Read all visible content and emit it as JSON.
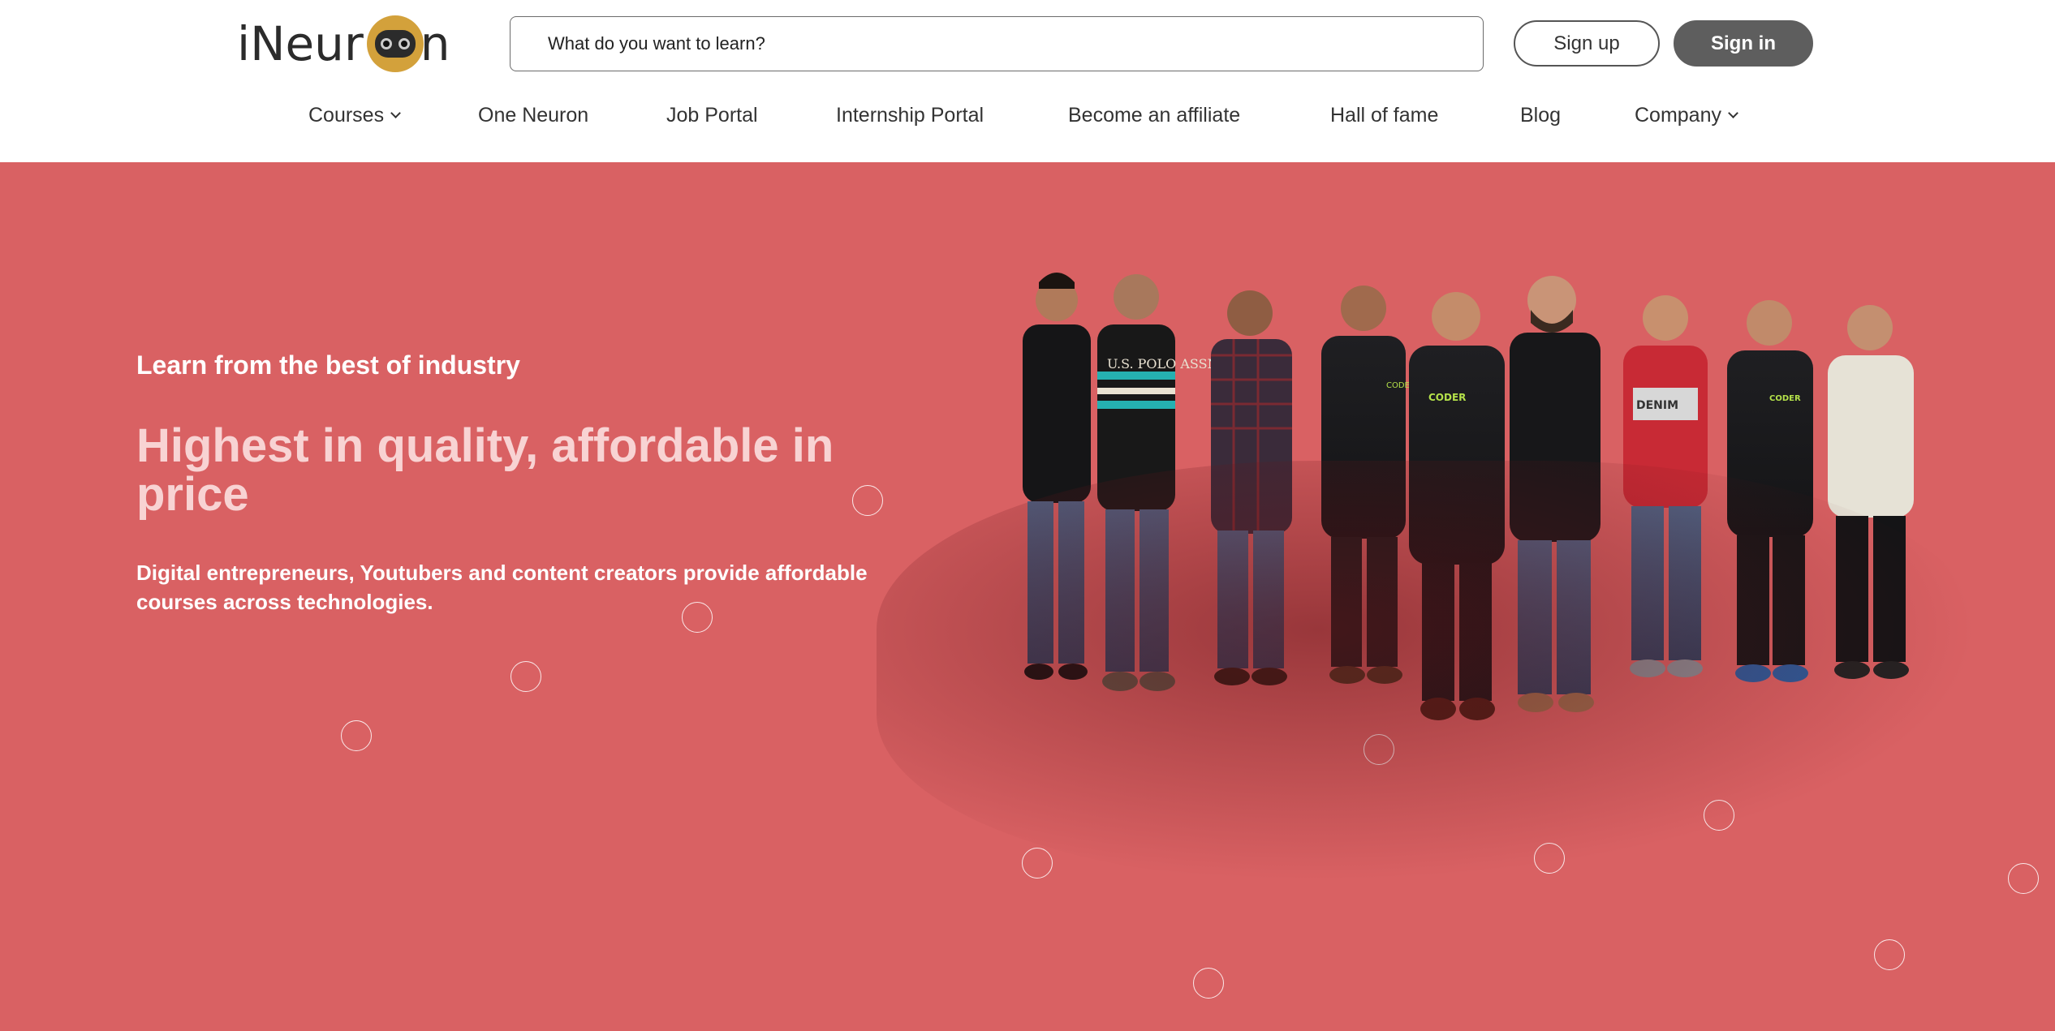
{
  "logo": {
    "text_before": "iNeur",
    "text_after": "n"
  },
  "search": {
    "placeholder": "What do you want to learn?"
  },
  "auth": {
    "signup_label": "Sign up",
    "signin_label": "Sign in"
  },
  "nav": {
    "items": [
      {
        "label": "Courses",
        "dropdown": true
      },
      {
        "label": "One Neuron",
        "dropdown": false
      },
      {
        "label": "Job Portal",
        "dropdown": false
      },
      {
        "label": "Internship Portal",
        "dropdown": false
      },
      {
        "label": "Become an affiliate",
        "dropdown": false
      },
      {
        "label": "Hall of fame",
        "dropdown": false
      },
      {
        "label": "Blog",
        "dropdown": false
      },
      {
        "label": "Company",
        "dropdown": true
      }
    ]
  },
  "hero": {
    "kicker": "Learn from the best of industry",
    "headline": "Highest in quality, affordable in price",
    "description": "Digital entrepreneurs, Youtubers and content creators provide affordable courses across technologies.",
    "background_color": "#d96163",
    "team_photo": "team-photo-nine-people",
    "shirt_texts": [
      "U.S. POLO ASSN",
      "CODER",
      "CODER",
      "CODER",
      "DENIM"
    ]
  },
  "colors": {
    "accent": "#d96163",
    "headline": "#f8d3d3",
    "signin_bg": "#5e5e5e"
  }
}
